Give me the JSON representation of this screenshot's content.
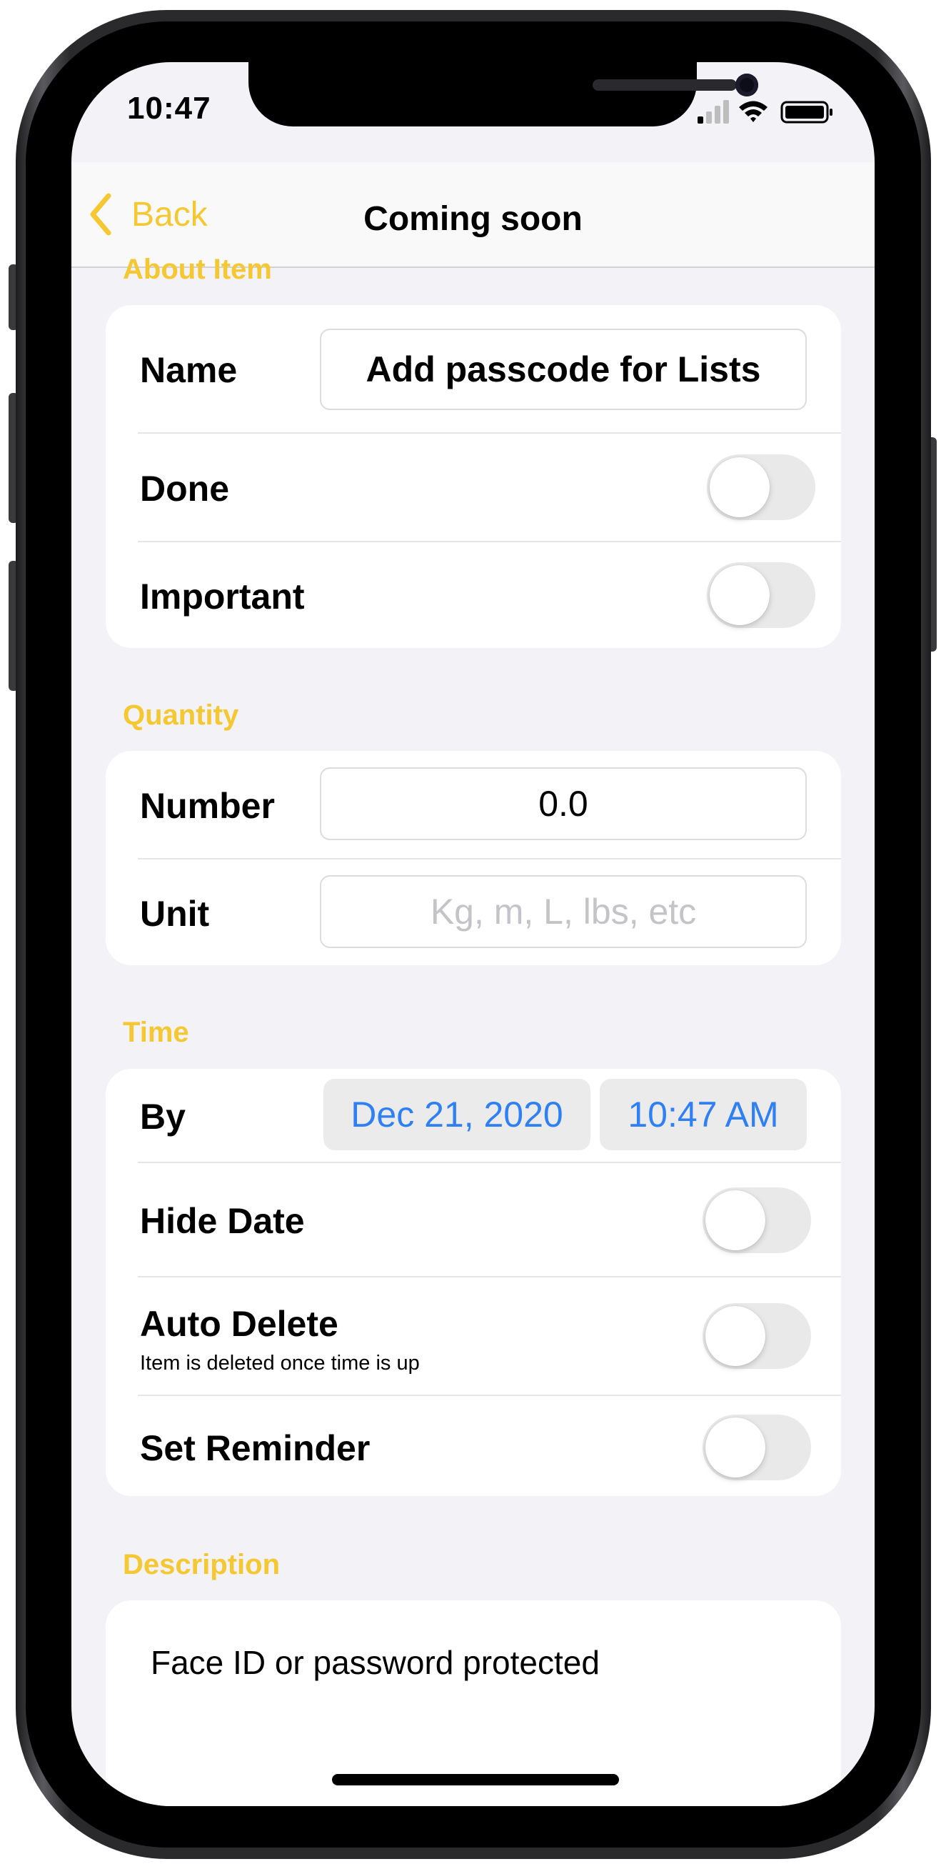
{
  "status": {
    "time": "10:47"
  },
  "nav": {
    "back_label": "Back",
    "title": "Coming soon"
  },
  "sections": {
    "about": "About Item",
    "quantity": "Quantity",
    "time": "Time",
    "description": "Description"
  },
  "about": {
    "name_label": "Name",
    "name_value": "Add passcode for Lists",
    "done_label": "Done",
    "done_on": false,
    "important_label": "Important",
    "important_on": false
  },
  "quantity": {
    "number_label": "Number",
    "number_value": "0.0",
    "unit_label": "Unit",
    "unit_placeholder": "Kg, m, L, lbs, etc"
  },
  "time": {
    "by_label": "By",
    "date_value": "Dec 21, 2020",
    "time_value": "10:47 AM",
    "hide_date_label": "Hide Date",
    "auto_delete_label": "Auto Delete",
    "auto_delete_sub": "Item is deleted once time is up",
    "set_reminder_label": "Set Reminder"
  },
  "description": {
    "text": "Face ID or password protected"
  },
  "colors": {
    "accent": "#f5c731",
    "link_blue": "#2f7ff5",
    "background": "#f2f2f7"
  },
  "icons": [
    "chevron-left-icon",
    "cellular-signal-icon",
    "wifi-icon",
    "battery-icon"
  ]
}
